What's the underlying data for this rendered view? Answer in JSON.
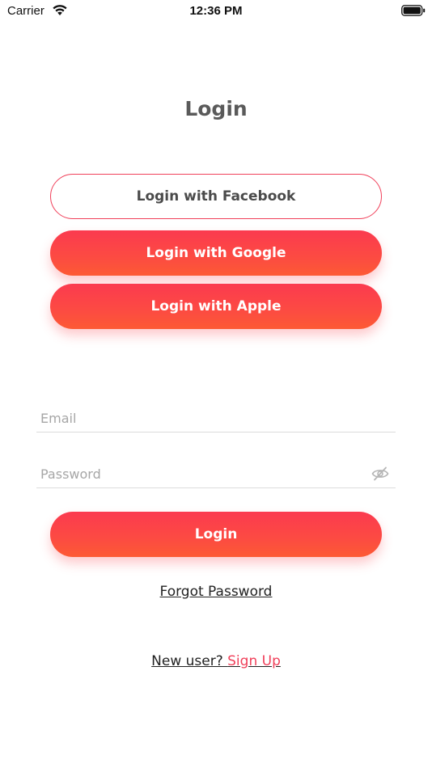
{
  "status_bar": {
    "carrier": "Carrier",
    "time": "12:36 PM",
    "wifi_icon": "wifi-icon",
    "battery_icon": "battery-icon"
  },
  "page": {
    "title": "Login"
  },
  "social_login": {
    "facebook_label": "Login with Facebook",
    "google_label": "Login with Google",
    "apple_label": "Login with Apple"
  },
  "form": {
    "email": {
      "placeholder": "Email",
      "value": ""
    },
    "password": {
      "placeholder": "Password",
      "value": "",
      "visibility_icon": "eye-slash-icon"
    },
    "submit_label": "Login"
  },
  "links": {
    "forgot_password": "Forgot Password",
    "new_user_prompt": "New user? ",
    "sign_up": "Sign Up"
  },
  "colors": {
    "accent": "#f0405a",
    "gradient_top": "#fb3a4f",
    "gradient_bottom": "#fd5a34",
    "title_text": "#5a5a5a"
  }
}
